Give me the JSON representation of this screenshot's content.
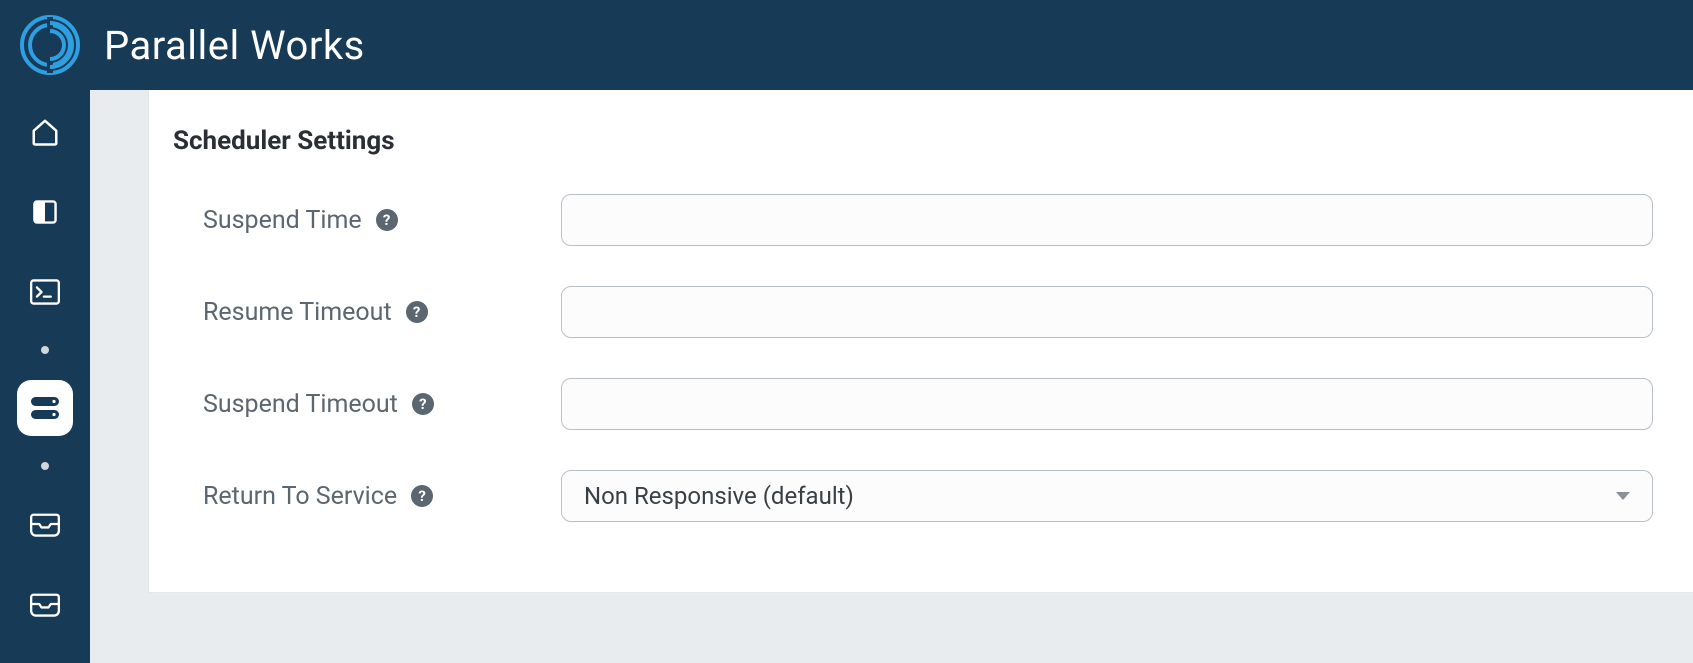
{
  "header": {
    "brand": "Parallel Works"
  },
  "sidebar": {
    "items": [
      {
        "name": "home"
      },
      {
        "name": "layout"
      },
      {
        "name": "terminal"
      },
      {
        "name": "storage",
        "active": true
      },
      {
        "name": "inbox"
      },
      {
        "name": "inbox2"
      }
    ]
  },
  "panel": {
    "title": "Scheduler Settings",
    "fields": {
      "suspend_time": {
        "label": "Suspend Time",
        "value": ""
      },
      "resume_timeout": {
        "label": "Resume Timeout",
        "value": ""
      },
      "suspend_timeout": {
        "label": "Suspend Timeout",
        "value": ""
      },
      "return_to_service": {
        "label": "Return To Service",
        "selected": "Non Responsive (default)"
      }
    }
  }
}
